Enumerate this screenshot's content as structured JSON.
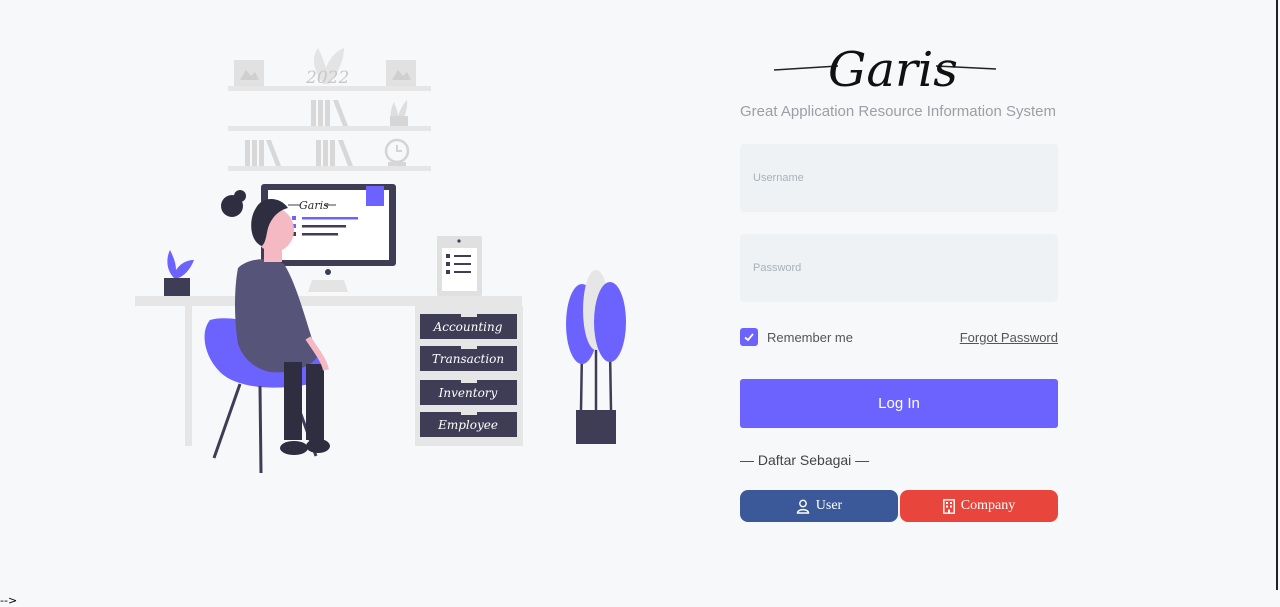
{
  "brand": {
    "logo_text": "Garis",
    "tagline": "Great Application Resource Information System"
  },
  "illustration": {
    "shelf_year": "2022",
    "screen_logo": "Garis",
    "drawers": [
      "Accounting",
      "Transaction",
      "Inventory",
      "Employee"
    ]
  },
  "form": {
    "username_placeholder": "Username",
    "password_placeholder": "Password",
    "remember_label": "Remember me",
    "remember_checked": true,
    "forgot_label": "Forgot Password",
    "login_label": "Log In",
    "register_heading": "— Daftar Sebagai —",
    "user_label": "User",
    "company_label": "Company",
    "user_icon": "user-icon",
    "company_icon": "building-icon"
  },
  "colors": {
    "accent": "#6c63ff",
    "user_button": "#3b5998",
    "company_button": "#e8453c",
    "field_bg": "#eef2f5"
  },
  "stray_text": "-->"
}
